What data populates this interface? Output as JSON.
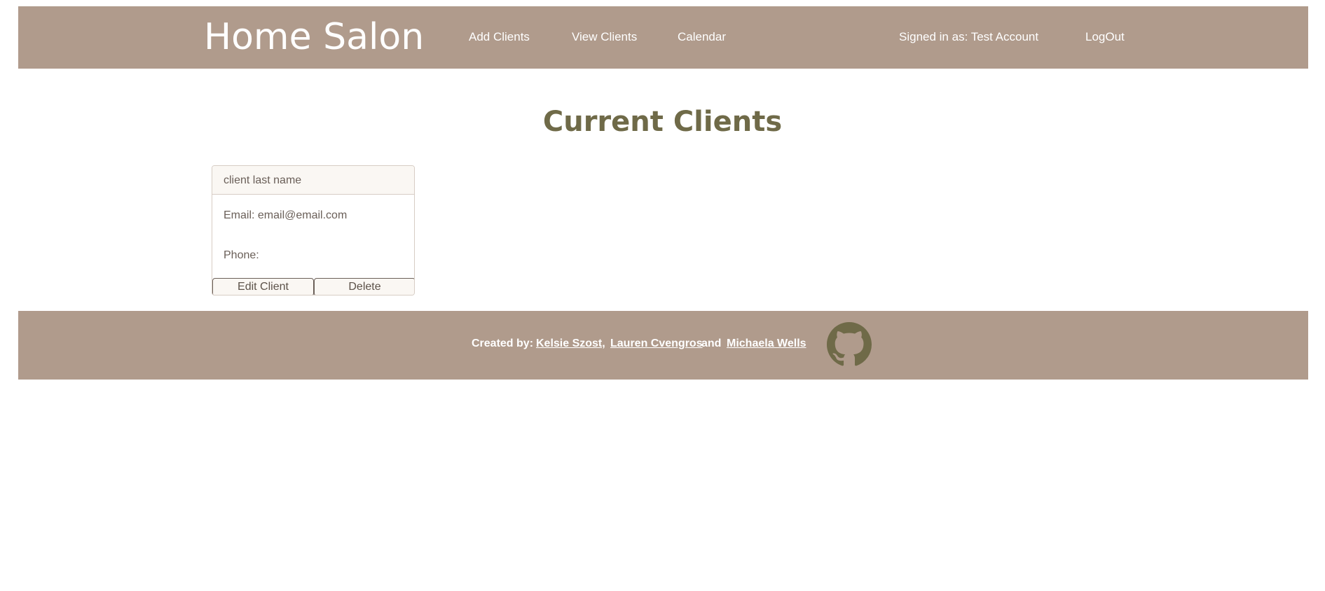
{
  "header": {
    "brand": "Home Salon",
    "nav": {
      "add_clients": "Add Clients",
      "view_clients": "View Clients",
      "calendar": "Calendar"
    },
    "signed_in": "Signed in as: Test Account",
    "logout": "LogOut"
  },
  "main": {
    "title": "Current Clients",
    "clients": [
      {
        "name": "client last name",
        "email": "Email: email@email.com",
        "phone": "Phone:",
        "edit_label": "Edit Client",
        "delete_label": "Delete"
      }
    ]
  },
  "footer": {
    "credit_label": "Created by:",
    "authors": [
      "Kelsie Szost,",
      "Lauren Cvengros",
      "Michaela Wells"
    ],
    "and_word": "and",
    "github_icon": "github-icon"
  },
  "colors": {
    "bar_background": "#b09b8c",
    "title_olive": "#6f6a48",
    "icon_olive": "#6f6a48",
    "card_header_bg": "#faf7f3",
    "text_muted": "#6a5f58"
  }
}
